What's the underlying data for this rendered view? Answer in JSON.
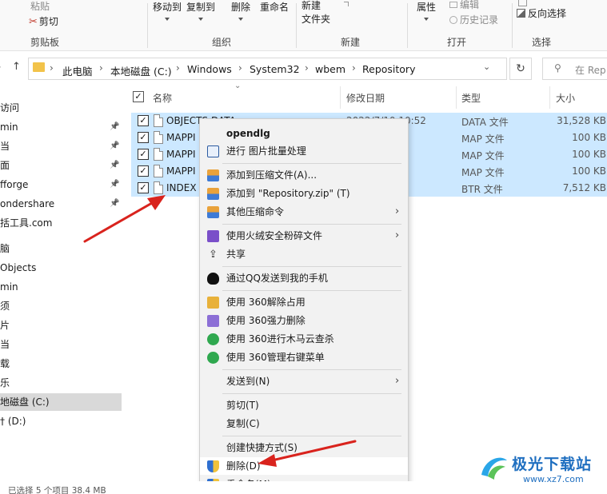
{
  "ribbon": {
    "clipboard": {
      "paste": "粘贴",
      "cut": "剪切",
      "group": "剪贴板"
    },
    "organize": {
      "move_to": "移动到",
      "copy_to": "复制到",
      "delete": "删除",
      "rename": "重命名",
      "group": "组织"
    },
    "new": {
      "new_folder_line1": "新建",
      "new_folder_line2": "文件夹",
      "group": "新建"
    },
    "open": {
      "properties": "属性",
      "edit": "编辑",
      "history": "历史记录",
      "group": "打开"
    },
    "select": {
      "invert": "反向选择",
      "group": "选择"
    }
  },
  "address": {
    "segments": [
      "此电脑",
      "本地磁盘 (C:)",
      "Windows",
      "System32",
      "wbem",
      "Repository"
    ],
    "search_placeholder": "在 Rep"
  },
  "nav": {
    "items": [
      {
        "label": "访问",
        "pinned": false
      },
      {
        "label": "min",
        "pinned": true
      },
      {
        "label": "当",
        "pinned": true
      },
      {
        "label": "面",
        "pinned": true
      },
      {
        "label": "fforge",
        "pinned": true
      },
      {
        "label": "ondershare",
        "pinned": true
      },
      {
        "label": "括工具.com",
        "pinned": false
      },
      {
        "label": "脑",
        "pinned": false
      },
      {
        "label": "Objects",
        "pinned": false
      },
      {
        "label": "min",
        "pinned": false
      },
      {
        "label": "须",
        "pinned": false
      },
      {
        "label": "片",
        "pinned": false
      },
      {
        "label": "当",
        "pinned": false
      },
      {
        "label": "载",
        "pinned": false
      },
      {
        "label": "乐",
        "pinned": false
      },
      {
        "label": "地磁盘 (C:)",
        "pinned": false,
        "selected": true
      },
      {
        "label": "† (D:)",
        "pinned": false
      }
    ]
  },
  "columns": {
    "name": "名称",
    "date": "修改日期",
    "type": "类型",
    "size": "大小"
  },
  "files": [
    {
      "name": "OBJECTS.DATA",
      "date": "2022/7/10 10:52",
      "type": "DATA 文件",
      "size": "31,528 KB"
    },
    {
      "name": "MAPPI",
      "date": "36",
      "type": "MAP 文件",
      "size": "100 KB"
    },
    {
      "name": "MAPPI",
      "date": "36",
      "type": "MAP 文件",
      "size": "100 KB"
    },
    {
      "name": "MAPPI",
      "date": "31",
      "type": "MAP 文件",
      "size": "100 KB"
    },
    {
      "name": "INDEX",
      "date": "52",
      "type": "BTR 文件",
      "size": "7,512 KB"
    }
  ],
  "context_menu": {
    "header": "opendlg",
    "batch": "进行 图片批量处理",
    "add_archive": "添加到压缩文件(A)...",
    "add_zip": "添加到 \"Repository.zip\" (T)",
    "other_compress": "其他压缩命令",
    "shred": "使用火绒安全粉碎文件",
    "share": "共享",
    "qq_send": "通过QQ发送到我的手机",
    "unlock_360": "使用 360解除占用",
    "force_delete_360": "使用 360强力删除",
    "scan_360": "使用 360进行木马云查杀",
    "menu_mgr_360": "使用 360管理右键菜单",
    "send_to": "发送到(N)",
    "cut": "剪切(T)",
    "copy": "复制(C)",
    "create_shortcut": "创建快捷方式(S)",
    "delete": "删除(D)",
    "rename": "重命名(M)"
  },
  "status": {
    "text": "已选择 5 个项目  38.4 MB"
  },
  "watermark": {
    "title": "极光下载站",
    "url": "www.xz7.com"
  },
  "colors": {
    "selection": "#cce8ff",
    "accent": "#0078d4",
    "arrow": "#d9231d"
  }
}
